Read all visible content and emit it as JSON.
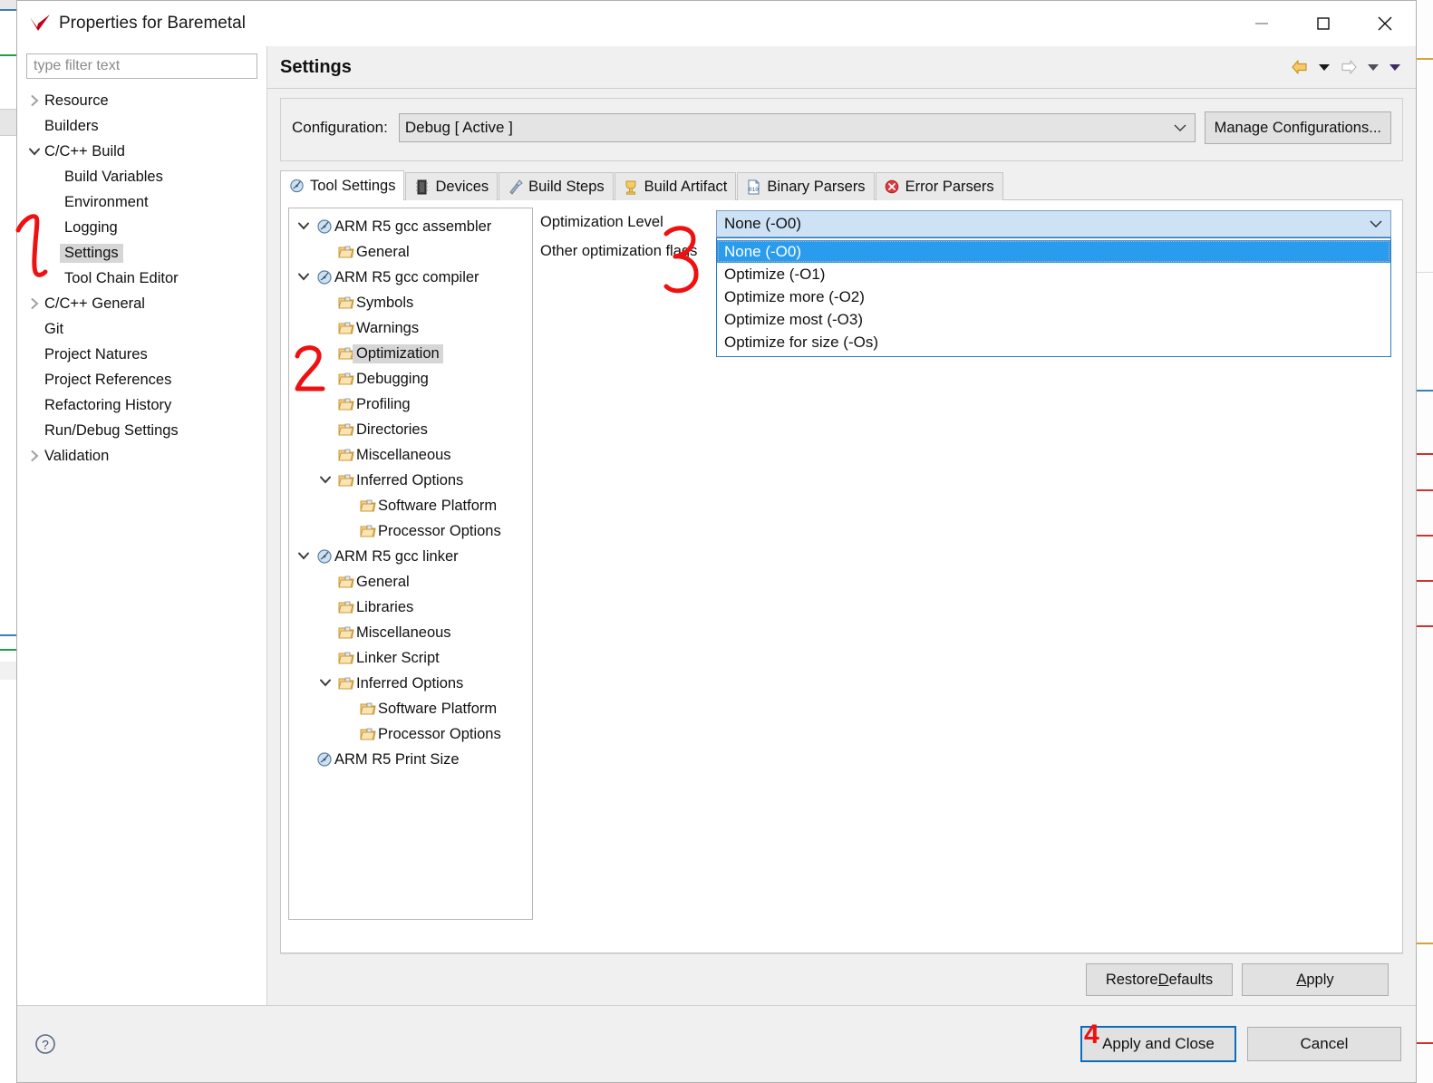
{
  "window": {
    "title": "Properties for Baremetal",
    "icon": "eclipse-checkmark-icon",
    "minimize_label": "—",
    "maximize_label": "☐",
    "close_label": "✕"
  },
  "filter": {
    "placeholder": "type filter text",
    "value": ""
  },
  "nav_tree": [
    {
      "label": "Resource",
      "indent": 0,
      "arrow": "collapsed",
      "selected": false
    },
    {
      "label": "Builders",
      "indent": 0,
      "arrow": "none",
      "selected": false
    },
    {
      "label": "C/C++ Build",
      "indent": 0,
      "arrow": "expanded",
      "selected": false
    },
    {
      "label": "Build Variables",
      "indent": 1,
      "arrow": "none",
      "selected": false
    },
    {
      "label": "Environment",
      "indent": 1,
      "arrow": "none",
      "selected": false
    },
    {
      "label": "Logging",
      "indent": 1,
      "arrow": "none",
      "selected": false
    },
    {
      "label": "Settings",
      "indent": 1,
      "arrow": "none",
      "selected": true
    },
    {
      "label": "Tool Chain Editor",
      "indent": 1,
      "arrow": "none",
      "selected": false
    },
    {
      "label": "C/C++ General",
      "indent": 0,
      "arrow": "collapsed",
      "selected": false
    },
    {
      "label": "Git",
      "indent": 0,
      "arrow": "none",
      "selected": false
    },
    {
      "label": "Project Natures",
      "indent": 0,
      "arrow": "none",
      "selected": false
    },
    {
      "label": "Project References",
      "indent": 0,
      "arrow": "none",
      "selected": false
    },
    {
      "label": "Refactoring History",
      "indent": 0,
      "arrow": "none",
      "selected": false
    },
    {
      "label": "Run/Debug Settings",
      "indent": 0,
      "arrow": "none",
      "selected": false
    },
    {
      "label": "Validation",
      "indent": 0,
      "arrow": "collapsed",
      "selected": false
    }
  ],
  "page": {
    "title": "Settings",
    "nav": {
      "back_icon": "back-arrow-icon",
      "back_menu_icon": "chevron-down-icon",
      "forward_icon": "forward-arrow-icon",
      "forward_menu_icon": "chevron-down-icon",
      "view_menu_icon": "chevron-down-icon"
    }
  },
  "configuration": {
    "label": "Configuration:",
    "value": "Debug  [ Active ]",
    "caret_icon": "chevron-down-icon",
    "manage_button": "Manage Configurations..."
  },
  "tabs": [
    {
      "label": "Tool Settings",
      "icon": "tool-settings-icon",
      "active": true
    },
    {
      "label": "Devices",
      "icon": "devices-icon",
      "active": false
    },
    {
      "label": "Build Steps",
      "icon": "build-steps-icon",
      "active": false
    },
    {
      "label": "Build Artifact",
      "icon": "build-artifact-icon",
      "active": false
    },
    {
      "label": "Binary Parsers",
      "icon": "binary-parsers-icon",
      "active": false
    },
    {
      "label": "Error Parsers",
      "icon": "error-parsers-icon",
      "active": false
    }
  ],
  "tool_tree": [
    {
      "label": "ARM R5 gcc assembler",
      "level": 0,
      "arrow": "expanded",
      "icon": "tool-icon",
      "selected": false
    },
    {
      "label": "General",
      "level": 1,
      "arrow": "none",
      "icon": "folder-icon",
      "selected": false
    },
    {
      "label": "ARM R5 gcc compiler",
      "level": 0,
      "arrow": "expanded",
      "icon": "tool-icon",
      "selected": false
    },
    {
      "label": "Symbols",
      "level": 1,
      "arrow": "none",
      "icon": "folder-icon",
      "selected": false
    },
    {
      "label": "Warnings",
      "level": 1,
      "arrow": "none",
      "icon": "folder-icon",
      "selected": false
    },
    {
      "label": "Optimization",
      "level": 1,
      "arrow": "none",
      "icon": "folder-icon",
      "selected": true
    },
    {
      "label": "Debugging",
      "level": 1,
      "arrow": "none",
      "icon": "folder-icon",
      "selected": false
    },
    {
      "label": "Profiling",
      "level": 1,
      "arrow": "none",
      "icon": "folder-icon",
      "selected": false
    },
    {
      "label": "Directories",
      "level": 1,
      "arrow": "none",
      "icon": "folder-icon",
      "selected": false
    },
    {
      "label": "Miscellaneous",
      "level": 1,
      "arrow": "none",
      "icon": "folder-icon",
      "selected": false
    },
    {
      "label": "Inferred Options",
      "level": 1,
      "arrow": "expanded",
      "icon": "folder-icon",
      "selected": false
    },
    {
      "label": "Software Platform",
      "level": 2,
      "arrow": "none",
      "icon": "folder-icon",
      "selected": false
    },
    {
      "label": "Processor Options",
      "level": 2,
      "arrow": "none",
      "icon": "folder-icon",
      "selected": false
    },
    {
      "label": "ARM R5 gcc linker",
      "level": 0,
      "arrow": "expanded",
      "icon": "tool-icon",
      "selected": false
    },
    {
      "label": "General",
      "level": 1,
      "arrow": "none",
      "icon": "folder-icon",
      "selected": false
    },
    {
      "label": "Libraries",
      "level": 1,
      "arrow": "none",
      "icon": "folder-icon",
      "selected": false
    },
    {
      "label": "Miscellaneous",
      "level": 1,
      "arrow": "none",
      "icon": "folder-icon",
      "selected": false
    },
    {
      "label": "Linker Script",
      "level": 1,
      "arrow": "none",
      "icon": "folder-icon",
      "selected": false
    },
    {
      "label": "Inferred Options",
      "level": 1,
      "arrow": "expanded",
      "icon": "folder-icon",
      "selected": false
    },
    {
      "label": "Software Platform",
      "level": 2,
      "arrow": "none",
      "icon": "folder-icon",
      "selected": false
    },
    {
      "label": "Processor Options",
      "level": 2,
      "arrow": "none",
      "icon": "folder-icon",
      "selected": false
    },
    {
      "label": "ARM R5 Print Size",
      "level": 0,
      "arrow": "none",
      "icon": "tool-icon",
      "selected": false
    }
  ],
  "options": {
    "optimization_level_label": "Optimization Level",
    "optimization_level_value": "None (-O0)",
    "other_flags_label": "Other optimization flags",
    "other_flags_value": "",
    "caret_icon": "chevron-down-icon",
    "dropdown_open": true,
    "dropdown_items": [
      {
        "label": "None (-O0)",
        "selected": true
      },
      {
        "label": "Optimize (-O1)",
        "selected": false
      },
      {
        "label": "Optimize more (-O2)",
        "selected": false
      },
      {
        "label": "Optimize most (-O3)",
        "selected": false
      },
      {
        "label": "Optimize for size (-Os)",
        "selected": false
      }
    ]
  },
  "buttons": {
    "restore_defaults_pre": "Restore ",
    "restore_defaults_mnemonic": "D",
    "restore_defaults_post": "efaults",
    "apply_mnemonic": "A",
    "apply_post": "pply",
    "apply_and_close": "Apply and Close",
    "cancel": "Cancel",
    "help_icon": "help-question-icon"
  },
  "annotations": [
    {
      "text": "1",
      "target": "settings-nav-item"
    },
    {
      "text": "2",
      "target": "optimization-tool-item"
    },
    {
      "text": "3",
      "target": "optimization-level-combo"
    },
    {
      "text": "4",
      "target": "apply-and-close-button"
    }
  ],
  "colors": {
    "accent_blue": "#2a9ced",
    "combo_blue": "#cde3f5",
    "default_button_border": "#0a6ebd",
    "annotation_red": "#ee1111",
    "selection_gray": "#d6d6d6"
  }
}
